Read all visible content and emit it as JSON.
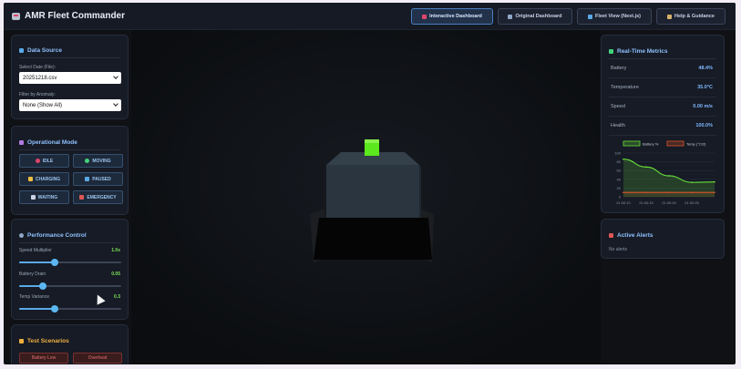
{
  "header": {
    "title": "AMR Fleet Commander",
    "nav": [
      {
        "label": "Interactive Dashboard",
        "active": true,
        "icon": "robot-icon"
      },
      {
        "label": "Original Dashboard",
        "active": false,
        "icon": "chart-icon"
      },
      {
        "label": "Fleet View (Next.js)",
        "active": false,
        "icon": "bar-chart-icon"
      },
      {
        "label": "Help & Guidance",
        "active": false,
        "icon": "help-icon"
      }
    ]
  },
  "data_source": {
    "title": "Data Source",
    "date_label": "Select Date (File):",
    "date_value": "20251218.csv",
    "filter_label": "Filter by Anomaly:",
    "filter_value": "None (Show All)"
  },
  "operational_mode": {
    "title": "Operational Mode",
    "modes": [
      {
        "label": "IDLE",
        "color": "#e0456a"
      },
      {
        "label": "MOVING",
        "color": "#42d17a"
      },
      {
        "label": "CHARGING",
        "color": "#f0c040"
      },
      {
        "label": "PAUSED",
        "color": "#5aa9e6"
      },
      {
        "label": "WAITING",
        "color": "#c9d3e3"
      },
      {
        "label": "EMERGENCY",
        "color": "#e05555"
      }
    ]
  },
  "performance": {
    "title": "Performance Control",
    "sliders": [
      {
        "label": "Speed Multiplier",
        "value": "1.0x",
        "fraction": 0.35
      },
      {
        "label": "Battery Drain",
        "value": "0.05",
        "fraction": 0.23
      },
      {
        "label": "Temp Variance",
        "value": "0.3",
        "fraction": 0.35
      }
    ]
  },
  "scenarios": {
    "title": "Test Scenarios",
    "buttons": [
      "Battery Low",
      "Overheat"
    ]
  },
  "metrics": {
    "title": "Real-Time Metrics",
    "rows": [
      {
        "label": "Battery",
        "value": "48.4%"
      },
      {
        "label": "Temperature",
        "value": "35.0°C"
      },
      {
        "label": "Speed",
        "value": "0.00 m/s"
      },
      {
        "label": "Health",
        "value": "100.0%"
      }
    ]
  },
  "alerts": {
    "title": "Active Alerts",
    "text": "No alerts"
  },
  "chart_data": {
    "type": "line",
    "x": [
      "21:00:10",
      "21:00:15",
      "21:00:20",
      "21:00:25",
      "21:00:30"
    ],
    "ylim": [
      0,
      100
    ],
    "yticks": [
      "100",
      "80",
      "60",
      "40",
      "20",
      "0"
    ],
    "xticks": [
      "21:00:10",
      "21:00:15",
      "21:00:20",
      "21:00:25"
    ],
    "series": [
      {
        "name": "Battery %",
        "color": "#6be13a",
        "values": [
          86,
          68,
          48,
          33,
          34
        ]
      },
      {
        "name": "Temp (°C/2)",
        "color": "#e0552a",
        "values": [
          10,
          10,
          10,
          10,
          10
        ]
      }
    ]
  }
}
